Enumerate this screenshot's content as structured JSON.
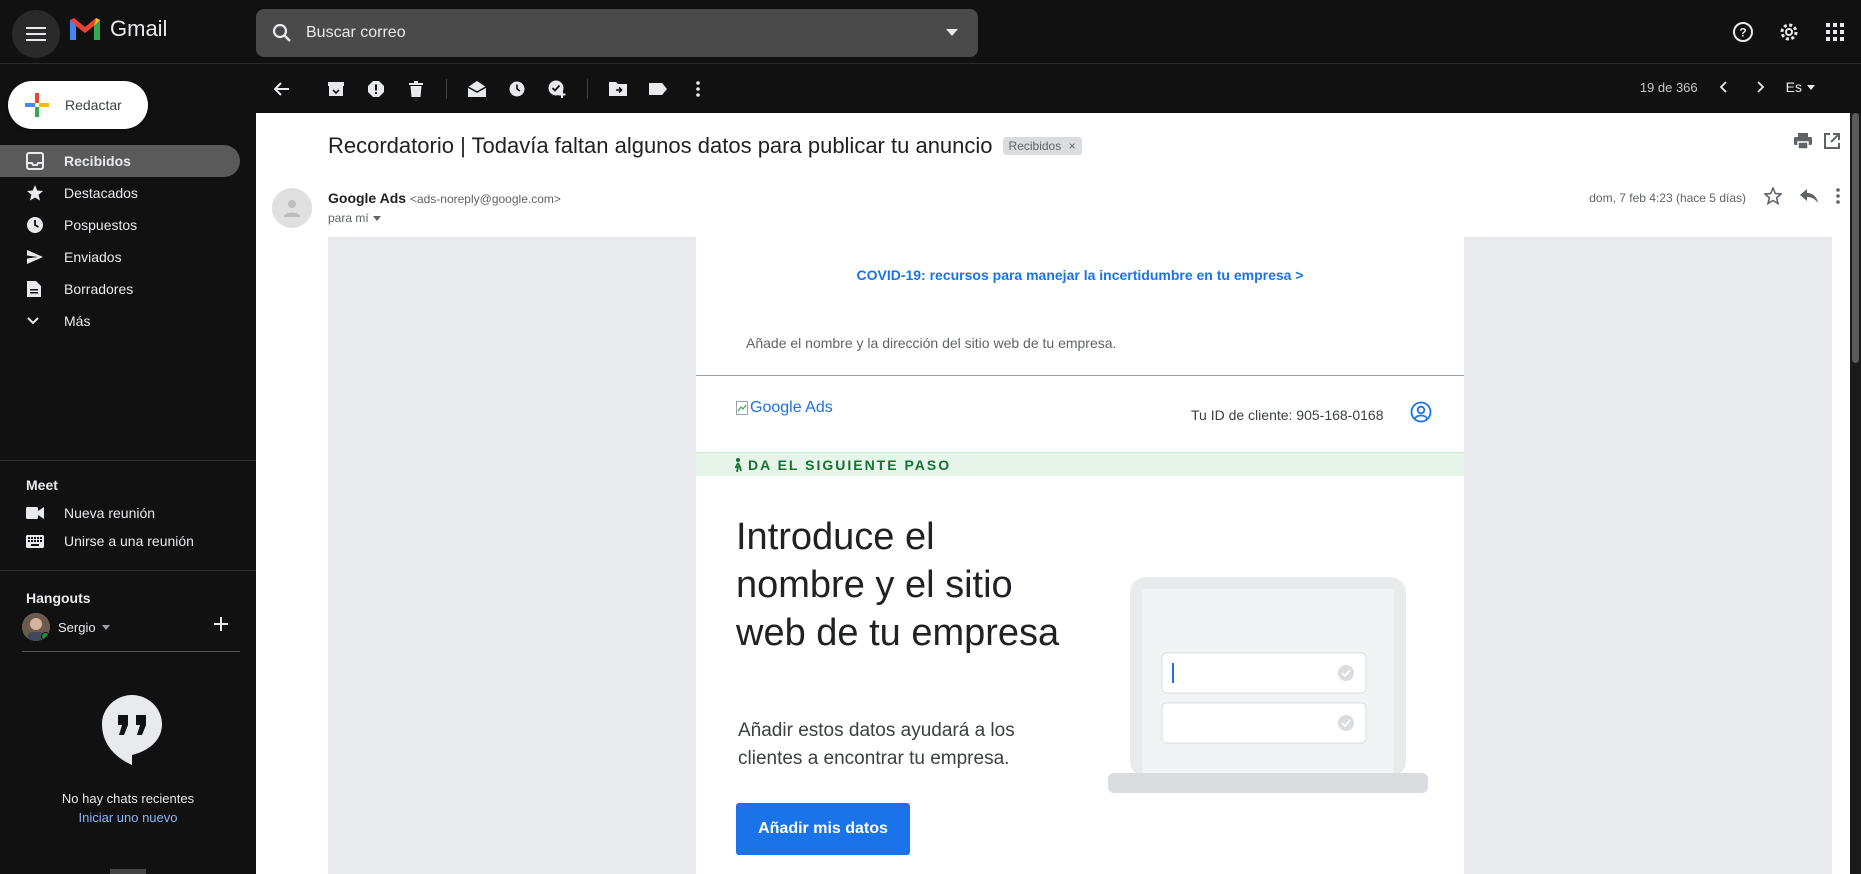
{
  "app": {
    "name": "Gmail"
  },
  "search": {
    "placeholder": "Buscar correo"
  },
  "sidebar": {
    "compose_label": "Redactar",
    "items": [
      {
        "label": "Recibidos",
        "icon": "inbox-icon",
        "active": true
      },
      {
        "label": "Destacados",
        "icon": "star-icon"
      },
      {
        "label": "Pospuestos",
        "icon": "clock-icon"
      },
      {
        "label": "Enviados",
        "icon": "send-icon"
      },
      {
        "label": "Borradores",
        "icon": "draft-icon"
      },
      {
        "label": "Más",
        "icon": "chevron-down-icon"
      }
    ],
    "meet": {
      "title": "Meet",
      "items": [
        {
          "label": "Nueva reunión",
          "icon": "video-icon"
        },
        {
          "label": "Unirse a una reunión",
          "icon": "keyboard-icon"
        }
      ]
    },
    "hangouts": {
      "title": "Hangouts",
      "user": "Sergio",
      "no_chats": "No hay chats recientes",
      "start_new": "Iniciar uno nuevo"
    }
  },
  "toolbar": {
    "pager": "19 de 366",
    "lang": "Es"
  },
  "email": {
    "subject": "Recordatorio | Todavía faltan algunos datos para publicar tu anuncio",
    "label_chip": "Recibidos",
    "sender_name": "Google Ads",
    "sender_addr": "<ads-noreply@google.com>",
    "to": "para mí",
    "date": "dom, 7 feb 4:23 (hace 5 días)",
    "body": {
      "covid_link": "COVID-19: recursos para manejar la incertidumbre en tu empresa >",
      "intro_line": "Añade el nombre y la dirección del sitio web de tu empresa.",
      "logo_alt": "Google Ads",
      "client_id": "Tu ID de cliente: 905-168-0168",
      "step_banner": "DA EL SIGUIENTE PASO",
      "hero_title": "Introduce el nombre y el sitio web de tu empresa",
      "hero_sub": "Añadir estos datos ayudará a los clientes a encontrar tu empresa.",
      "cta": "Añadir mis datos"
    }
  },
  "colors": {
    "background": "#111111",
    "active_nav": "#5a5a5a",
    "link_blue": "#1a73e8",
    "hangouts_link": "#8ab4f8",
    "step_green": "#137333"
  }
}
